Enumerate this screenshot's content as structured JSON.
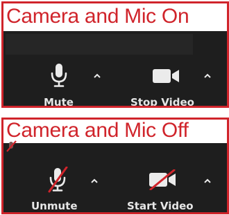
{
  "panels": [
    {
      "title": "Camera and Mic On",
      "audio_label": "Mute",
      "video_label": "Stop Video",
      "audio_icon": "microphone-icon",
      "video_icon": "video-camera-icon"
    },
    {
      "title": "Camera and Mic Off",
      "audio_label": "Unmute",
      "video_label": "Start Video",
      "audio_icon": "microphone-muted-icon",
      "video_icon": "video-camera-off-icon"
    }
  ],
  "colors": {
    "accent_red": "#d0242b",
    "toolbar_bg": "#1e1e1e",
    "icon_fg": "#ebebeb"
  }
}
